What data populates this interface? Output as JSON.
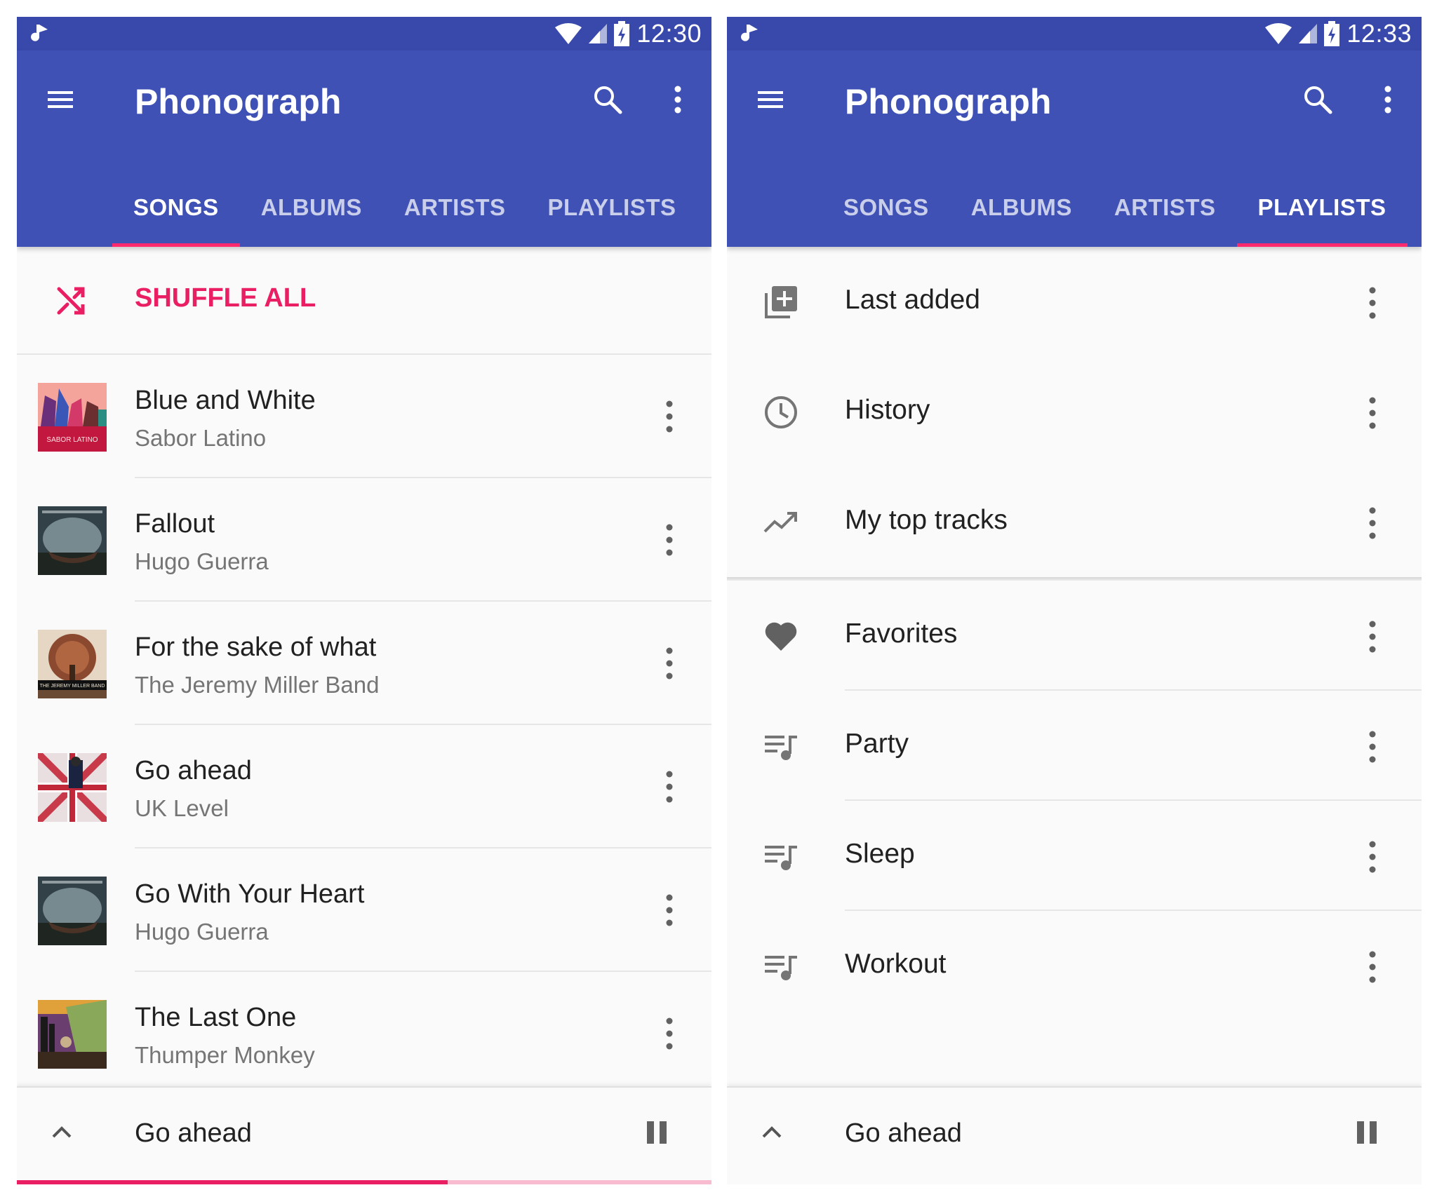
{
  "colors": {
    "primary": "#3f51b5",
    "primary_dark": "#3949ab",
    "accent": "#e91e63"
  },
  "left": {
    "status": {
      "time": "12:30"
    },
    "toolbar": {
      "title": "Phonograph"
    },
    "tabs": [
      {
        "label": "SONGS",
        "active": true
      },
      {
        "label": "ALBUMS",
        "active": false
      },
      {
        "label": "ARTISTS",
        "active": false
      },
      {
        "label": "PLAYLISTS",
        "active": false
      }
    ],
    "shuffle_label": "SHUFFLE ALL",
    "songs": [
      {
        "title": "Blue and White",
        "artist": "Sabor Latino"
      },
      {
        "title": "Fallout",
        "artist": "Hugo Guerra"
      },
      {
        "title": "For the sake of what",
        "artist": "The Jeremy Miller Band"
      },
      {
        "title": "Go ahead",
        "artist": "UK Level"
      },
      {
        "title": "Go With Your Heart",
        "artist": "Hugo Guerra"
      },
      {
        "title": "The Last One",
        "artist": "Thumper Monkey"
      }
    ],
    "album_art_text": {
      "sabor": "SABOR LATINO",
      "jeremy": "THE JEREMY MILLER BAND"
    },
    "now_playing": {
      "title": "Go ahead",
      "progress": 0.62
    }
  },
  "right": {
    "status": {
      "time": "12:33"
    },
    "toolbar": {
      "title": "Phonograph"
    },
    "tabs": [
      {
        "label": "SONGS",
        "active": false
      },
      {
        "label": "ALBUMS",
        "active": false
      },
      {
        "label": "ARTISTS",
        "active": false
      },
      {
        "label": "PLAYLISTS",
        "active": true
      }
    ],
    "smart_playlists": [
      {
        "label": "Last added",
        "icon": "library-add-icon"
      },
      {
        "label": "History",
        "icon": "clock-icon"
      },
      {
        "label": "My top tracks",
        "icon": "trending-up-icon"
      }
    ],
    "user_playlists": [
      {
        "label": "Favorites",
        "icon": "heart-icon"
      },
      {
        "label": "Party",
        "icon": "queue-music-icon"
      },
      {
        "label": "Sleep",
        "icon": "queue-music-icon"
      },
      {
        "label": "Workout",
        "icon": "queue-music-icon"
      }
    ],
    "now_playing": {
      "title": "Go ahead"
    }
  }
}
